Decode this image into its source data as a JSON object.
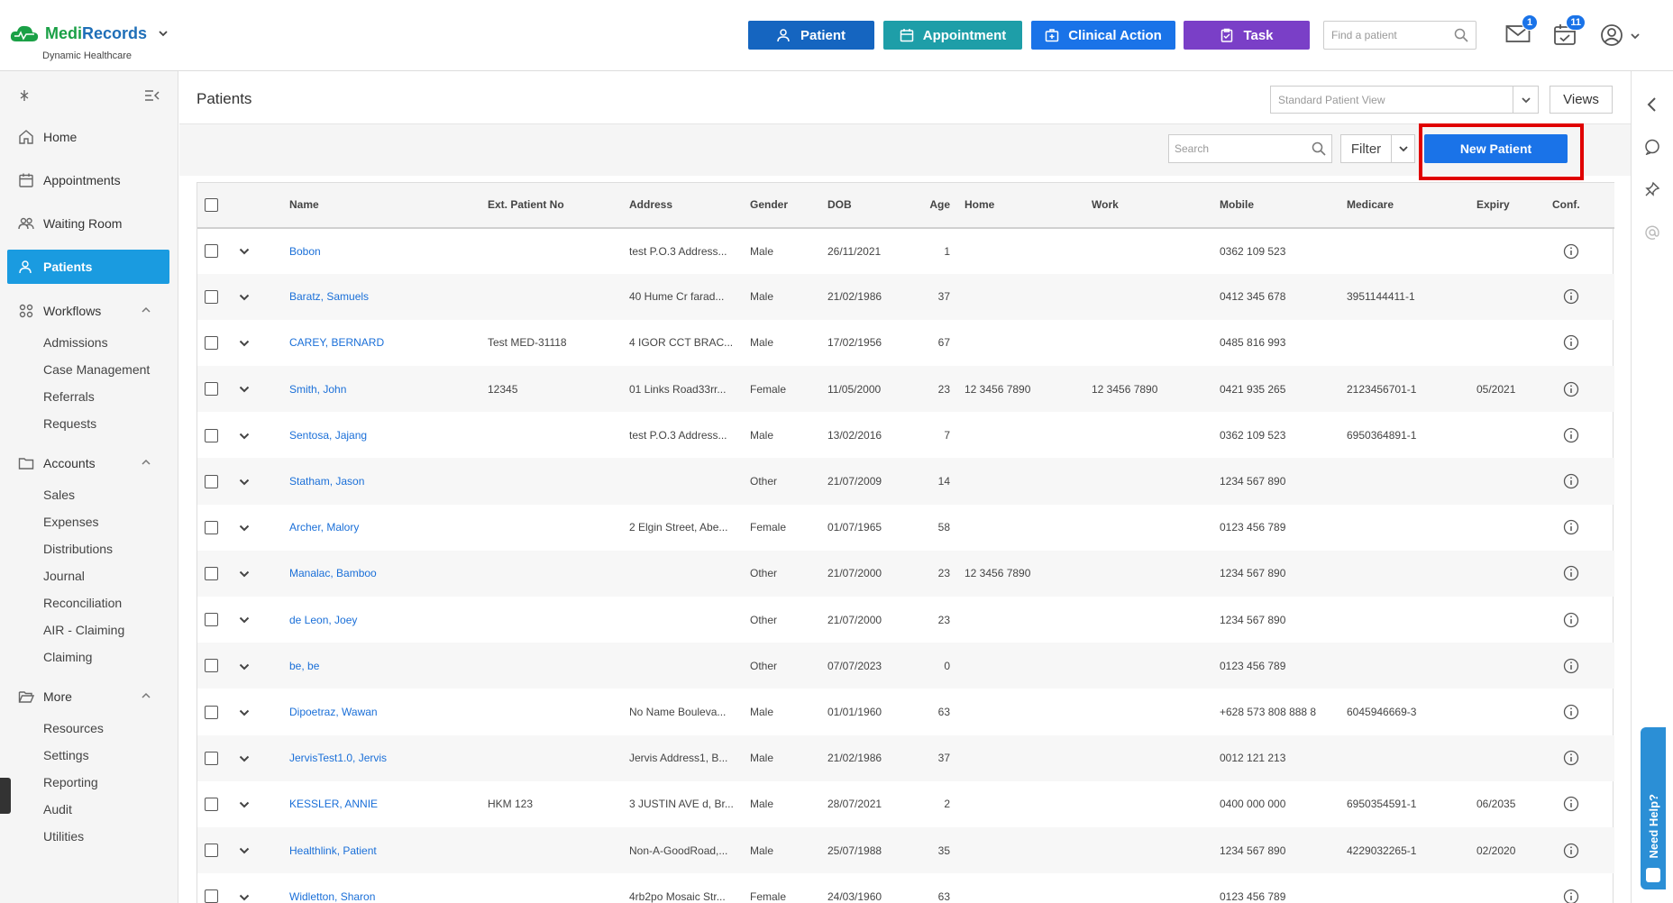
{
  "app": {
    "brand_a": "Medi",
    "brand_b": "Records",
    "subtitle": "Dynamic Healthcare"
  },
  "header": {
    "buttons": {
      "patient": "Patient",
      "appointment": "Appointment",
      "clinical_action": "Clinical Action",
      "task": "Task"
    },
    "find_placeholder": "Find a patient",
    "mail_badge": "1",
    "calendar_badge": "11"
  },
  "sidebar": {
    "home": "Home",
    "appointments": "Appointments",
    "waiting_room": "Waiting Room",
    "patients": "Patients",
    "workflows": "Workflows",
    "workflows_items": [
      "Admissions",
      "Case Management",
      "Referrals",
      "Requests"
    ],
    "accounts": "Accounts",
    "accounts_items": [
      "Sales",
      "Expenses",
      "Distributions",
      "Journal",
      "Reconciliation",
      "AIR - Claiming",
      "Claiming"
    ],
    "more": "More",
    "more_items": [
      "Resources",
      "Settings",
      "Reporting",
      "Audit",
      "Utilities"
    ]
  },
  "main": {
    "title": "Patients",
    "view_select": "Standard Patient View",
    "views_btn": "Views",
    "search_placeholder": "Search",
    "filter": "Filter",
    "new_patient": "New Patient"
  },
  "table": {
    "columns": {
      "name": "Name",
      "ext": "Ext. Patient No",
      "address": "Address",
      "gender": "Gender",
      "dob": "DOB",
      "age": "Age",
      "home": "Home",
      "work": "Work",
      "mobile": "Mobile",
      "medicare": "Medicare",
      "expiry": "Expiry",
      "conf": "Conf."
    },
    "rows": [
      {
        "name": "Bobon",
        "ext": "",
        "address": "test P.O.3 Address...",
        "gender": "Male",
        "dob": "26/11/2021",
        "age": "1",
        "home": "",
        "work": "",
        "mobile": "0362 109 523",
        "medicare": "",
        "expiry": ""
      },
      {
        "name": "Baratz, Samuels",
        "ext": "",
        "address": "40 Hume Cr farad...",
        "gender": "Male",
        "dob": "21/02/1986",
        "age": "37",
        "home": "",
        "work": "",
        "mobile": "0412 345 678",
        "medicare": "3951144411-1",
        "expiry": ""
      },
      {
        "name": "CAREY, BERNARD",
        "ext": "Test MED-31118",
        "address": "4 IGOR CCT BRAC...",
        "gender": "Male",
        "dob": "17/02/1956",
        "age": "67",
        "home": "",
        "work": "",
        "mobile": "0485 816 993",
        "medicare": "",
        "expiry": ""
      },
      {
        "name": "Smith, John",
        "ext": "12345",
        "address": "01 Links Road33rr...",
        "gender": "Female",
        "dob": "11/05/2000",
        "age": "23",
        "home": "12 3456 7890",
        "work": "12 3456 7890",
        "mobile": "0421 935 265",
        "medicare": "2123456701-1",
        "expiry": "05/2021"
      },
      {
        "name": "Sentosa, Jajang",
        "ext": "",
        "address": "test P.O.3 Address...",
        "gender": "Male",
        "dob": "13/02/2016",
        "age": "7",
        "home": "",
        "work": "",
        "mobile": "0362 109 523",
        "medicare": "6950364891-1",
        "expiry": ""
      },
      {
        "name": "Statham, Jason",
        "ext": "",
        "address": "",
        "gender": "Other",
        "dob": "21/07/2009",
        "age": "14",
        "home": "",
        "work": "",
        "mobile": "1234 567 890",
        "medicare": "",
        "expiry": ""
      },
      {
        "name": "Archer, Malory",
        "ext": "",
        "address": "2 Elgin Street, Abe...",
        "gender": "Female",
        "dob": "01/07/1965",
        "age": "58",
        "home": "",
        "work": "",
        "mobile": "0123 456 789",
        "medicare": "",
        "expiry": ""
      },
      {
        "name": "Manalac, Bamboo",
        "ext": "",
        "address": "",
        "gender": "Other",
        "dob": "21/07/2000",
        "age": "23",
        "home": "12 3456 7890",
        "work": "",
        "mobile": "1234 567 890",
        "medicare": "",
        "expiry": ""
      },
      {
        "name": "de Leon, Joey",
        "ext": "",
        "address": "",
        "gender": "Other",
        "dob": "21/07/2000",
        "age": "23",
        "home": "",
        "work": "",
        "mobile": "1234 567 890",
        "medicare": "",
        "expiry": ""
      },
      {
        "name": "be, be",
        "ext": "",
        "address": "",
        "gender": "Other",
        "dob": "07/07/2023",
        "age": "0",
        "home": "",
        "work": "",
        "mobile": "0123 456 789",
        "medicare": "",
        "expiry": ""
      },
      {
        "name": "Dipoetraz, Wawan",
        "ext": "",
        "address": "No Name Bouleva...",
        "gender": "Male",
        "dob": "01/01/1960",
        "age": "63",
        "home": "",
        "work": "",
        "mobile": "+628 573 808 888 8",
        "medicare": "6045946669-3",
        "expiry": ""
      },
      {
        "name": "JervisTest1.0, Jervis",
        "ext": "",
        "address": "Jervis Address1, B...",
        "gender": "Male",
        "dob": "21/02/1986",
        "age": "37",
        "home": "",
        "work": "",
        "mobile": "0012 121 213",
        "medicare": "",
        "expiry": ""
      },
      {
        "name": "KESSLER, ANNIE",
        "ext": "HKM 123",
        "address": "3 JUSTIN AVE d, Br...",
        "gender": "Male",
        "dob": "28/07/2021",
        "age": "2",
        "home": "",
        "work": "",
        "mobile": "0400 000 000",
        "medicare": "6950354591-1",
        "expiry": "06/2035"
      },
      {
        "name": "Healthlink, Patient",
        "ext": "",
        "address": "Non-A-GoodRoad,...",
        "gender": "Male",
        "dob": "25/07/1988",
        "age": "35",
        "home": "",
        "work": "",
        "mobile": "1234 567 890",
        "medicare": "4229032265-1",
        "expiry": "02/2020"
      },
      {
        "name": "Widletton, Sharon",
        "ext": "",
        "address": "4rb2po Mosaic Str...",
        "gender": "Female",
        "dob": "24/03/1960",
        "age": "63",
        "home": "",
        "work": "",
        "mobile": "0123 456 789",
        "medicare": "",
        "expiry": ""
      }
    ]
  },
  "help": {
    "label": "Need Help?"
  },
  "colors": {
    "brand_green": "#1aa046",
    "brand_blue": "#1f6fb8",
    "primary": "#1a73e8",
    "active_nav": "#1a9be0",
    "task_purple": "#7a3fc7",
    "appointment_teal": "#1e9ea8",
    "highlight_red": "#e00000"
  }
}
